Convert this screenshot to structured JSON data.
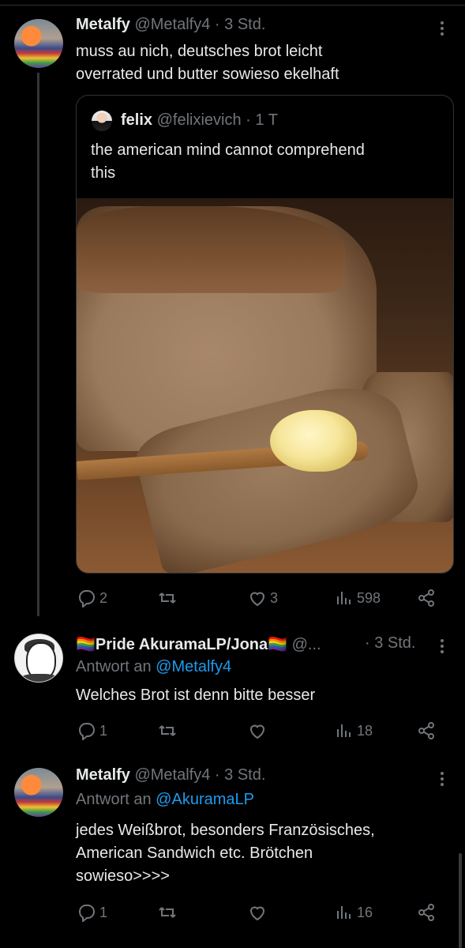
{
  "tweets": [
    {
      "name": "Metalfy",
      "handle": "@Metalfy4",
      "time": "3 Std.",
      "text_lines": [
        "muss au nich, deutsches brot leicht",
        "overrated und butter sowieso ekelhaft"
      ],
      "quote": {
        "name": "felix",
        "handle": "@felixievich",
        "time": "1 T",
        "text_lines": [
          "the american mind cannot comprehend",
          "this"
        ],
        "image_icon": "bread-and-butter-photo"
      },
      "stats": {
        "replies": "2",
        "reposts": "",
        "likes": "3",
        "views": "598"
      }
    },
    {
      "name": "🏳️‍🌈Pride AkuramaLP/Jona🏳️‍🌈",
      "handle": "@...",
      "time": "3 Std.",
      "reply_prefix": "Antwort an",
      "reply_to": "@Metalfy4",
      "text_lines": [
        "Welches Brot ist denn bitte besser"
      ],
      "stats": {
        "replies": "1",
        "reposts": "",
        "likes": "",
        "views": "18"
      }
    },
    {
      "name": "Metalfy",
      "handle": "@Metalfy4",
      "time": "3 Std.",
      "reply_prefix": "Antwort an",
      "reply_to": "@AkuramaLP",
      "text_lines": [
        "jedes Weißbrot, besonders Französisches,",
        "American Sandwich etc. Brötchen",
        "sowieso>>>>"
      ],
      "stats": {
        "replies": "1",
        "reposts": "",
        "likes": "",
        "views": "16"
      }
    }
  ],
  "separator": "·",
  "icons": [
    "reply-icon",
    "repost-icon",
    "like-icon",
    "views-icon",
    "share-icon",
    "more-icon"
  ],
  "colors": {
    "background": "#000000",
    "text": "#e7e9ea",
    "muted": "#71767b",
    "link": "#1d9bf0"
  }
}
